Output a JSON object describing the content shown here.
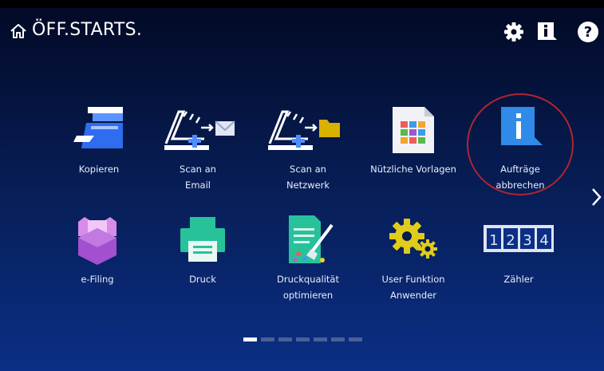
{
  "header": {
    "title": "ÖFF.STARTS."
  },
  "tiles": [
    {
      "label": "Kopieren",
      "label2": ""
    },
    {
      "label": "Scan an",
      "label2": "Email"
    },
    {
      "label": "Scan an",
      "label2": "Netzwerk"
    },
    {
      "label": "Nützliche Vorlagen",
      "label2": ""
    },
    {
      "label": "Aufträge",
      "label2": "abbrechen"
    },
    {
      "label": "e-Filing",
      "label2": ""
    },
    {
      "label": "Druck",
      "label2": ""
    },
    {
      "label": "Druckqualität",
      "label2": "optimieren"
    },
    {
      "label": "User Funktion",
      "label2": "Anwender"
    },
    {
      "label": "Zähler",
      "label2": ""
    }
  ],
  "counter_digits": [
    "1",
    "2",
    "3",
    "4"
  ],
  "pager": {
    "pages": 7,
    "active": 1
  },
  "colors": {
    "tile_blue": "#2f6cf0",
    "scan_yellow": "#d9b100",
    "efiling_purple": "#a24fd0",
    "print_green": "#27c29a",
    "gear_yellow": "#e1cc1a",
    "highlight_ring": "#b02531"
  },
  "icons": [
    "home-icon",
    "gear-icon",
    "info-icon",
    "help-icon",
    "copy-icon",
    "scan-email-icon",
    "scan-network-icon",
    "template-icon",
    "cancel-job-icon",
    "efiling-icon",
    "print-icon",
    "quality-icon",
    "user-function-icon",
    "counter-icon",
    "chevron-right-icon"
  ]
}
